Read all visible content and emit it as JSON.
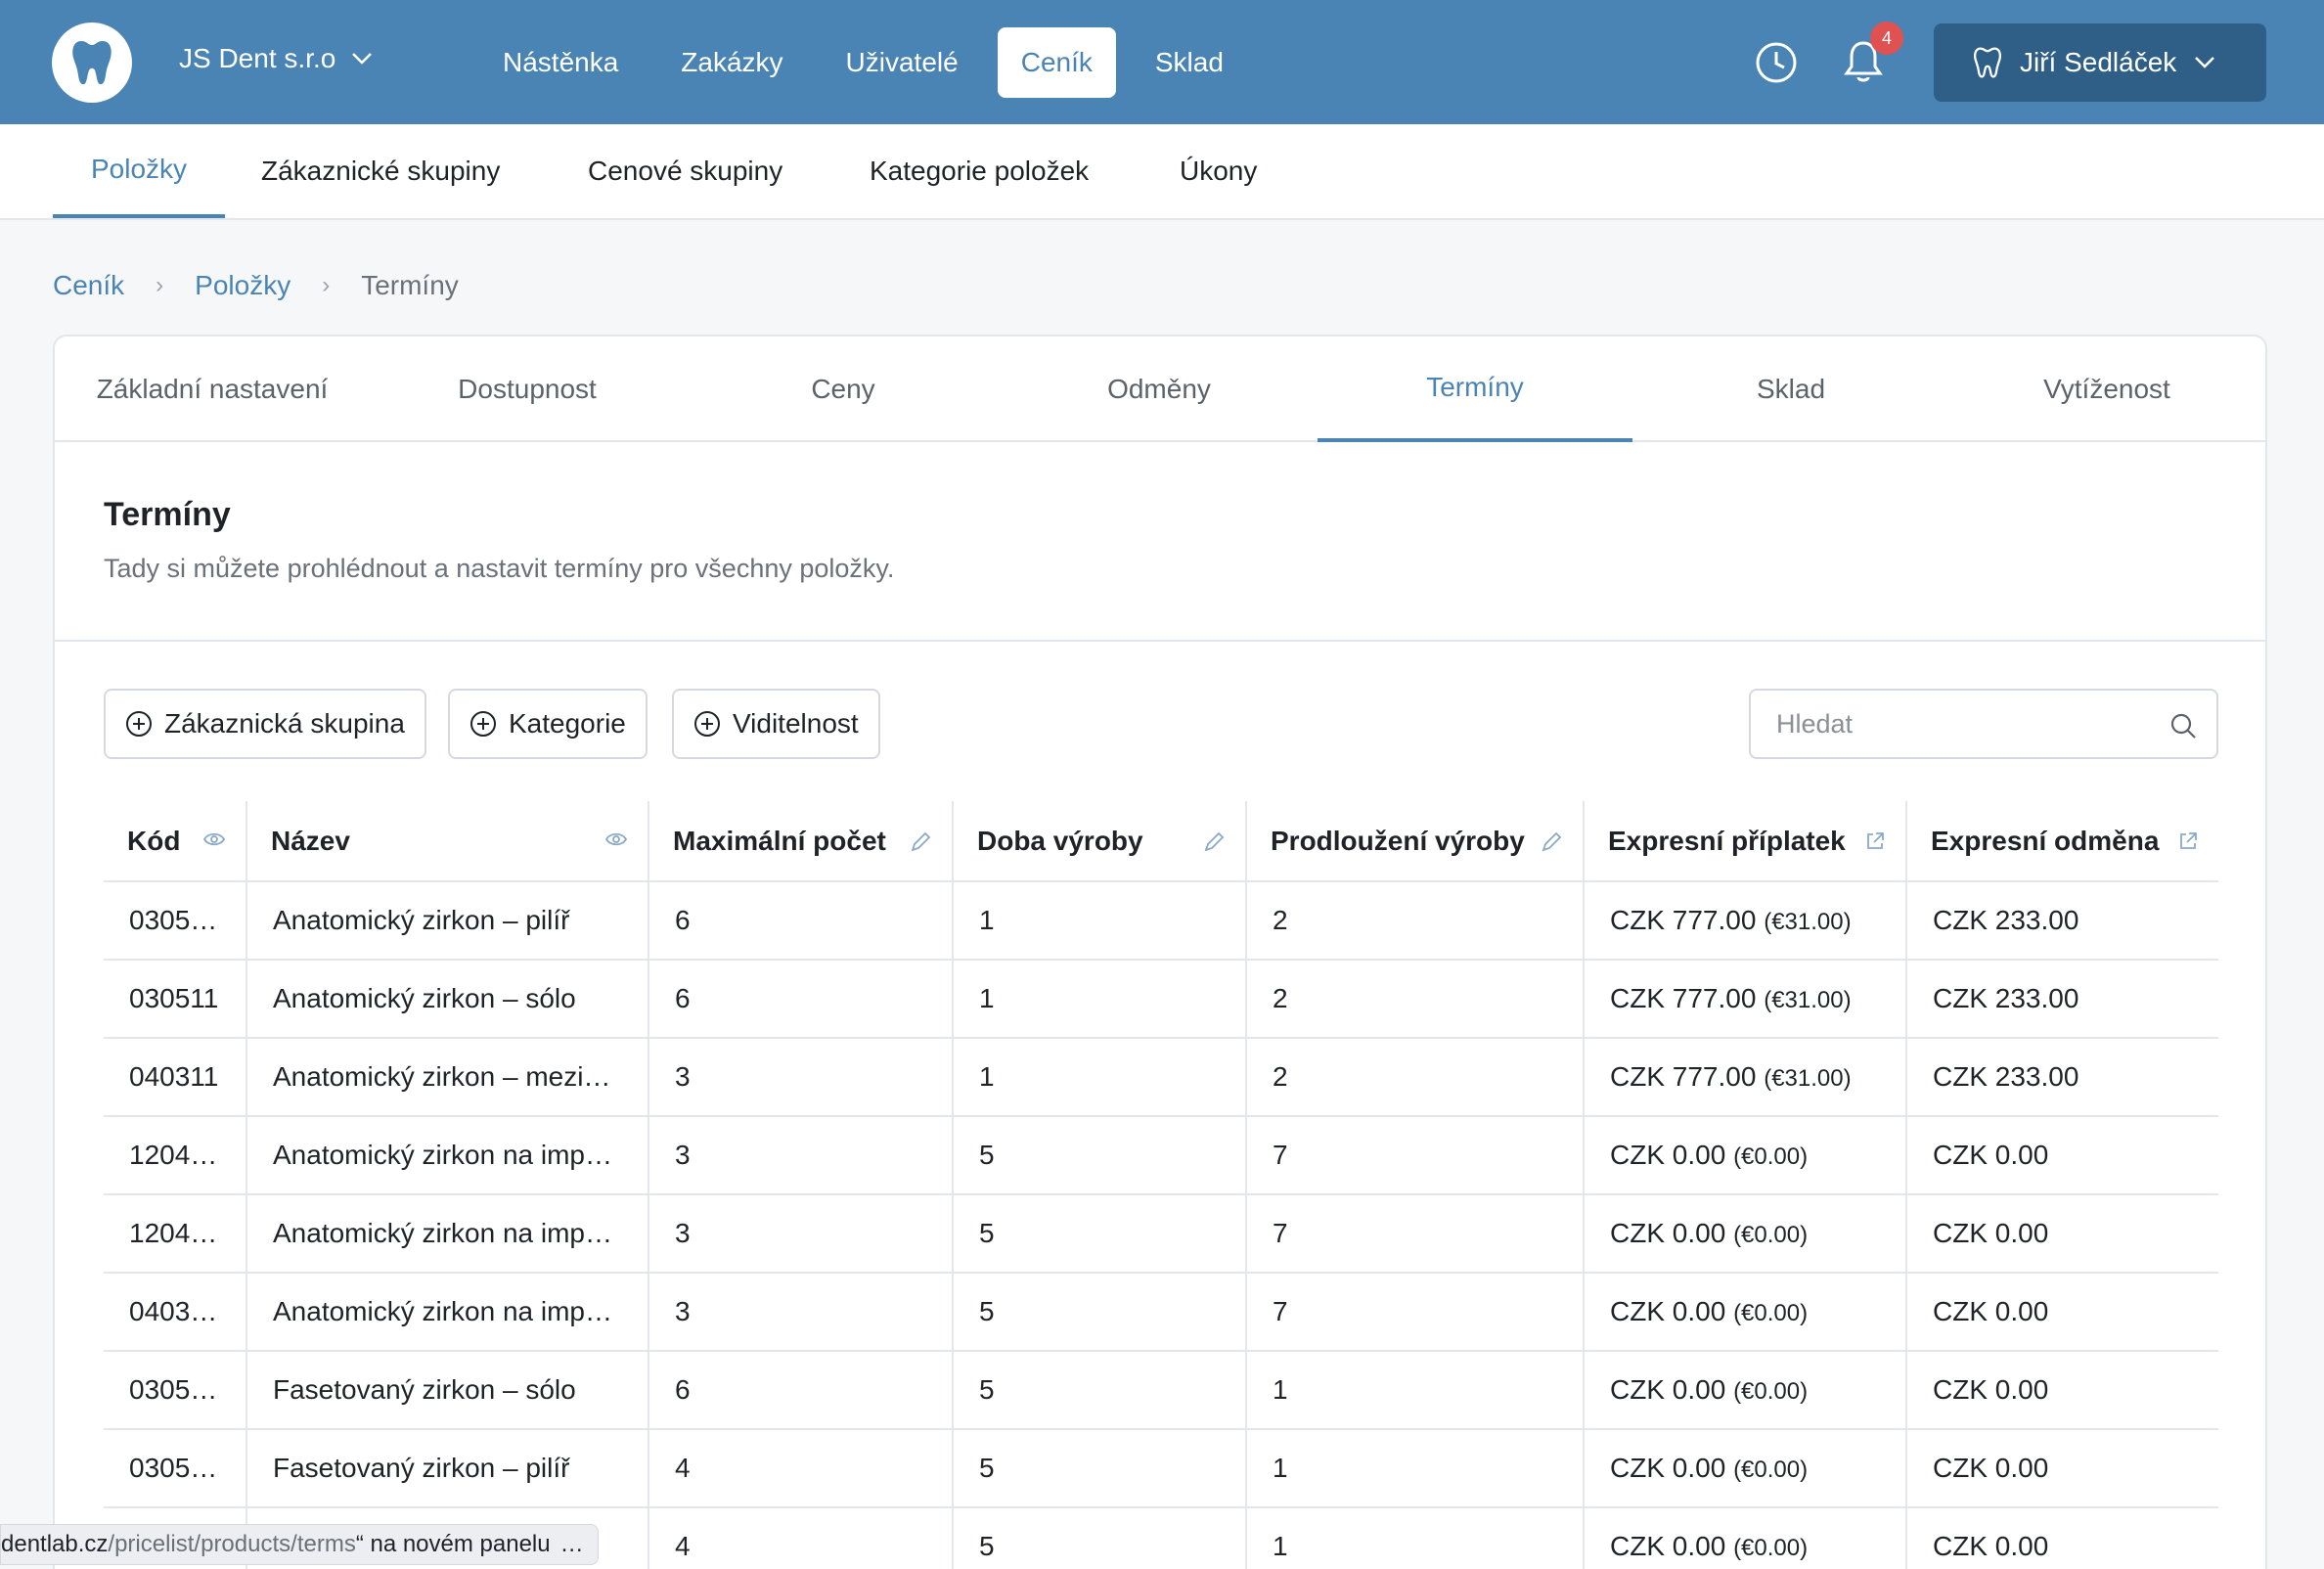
{
  "header": {
    "company": "JS Dent s.r.o",
    "nav": [
      "Nástěnka",
      "Zakázky",
      "Uživatelé",
      "Ceník",
      "Sklad"
    ],
    "active_nav": "Ceník",
    "notifications_count": "4",
    "user_name": "Jiří Sedláček",
    "colors": {
      "primary": "#4a84b4",
      "dark": "#2f5f86",
      "badge": "#e05252"
    }
  },
  "subtabs": [
    "Položky",
    "Zákaznické skupiny",
    "Cenové skupiny",
    "Kategorie položek",
    "Úkony"
  ],
  "breadcrumb": {
    "level1": "Ceník",
    "level2": "Položky",
    "current": "Termíny"
  },
  "panel_tabs": [
    "Základní nastavení",
    "Dostupnost",
    "Ceny",
    "Odměny",
    "Termíny",
    "Sklad",
    "Vytíženost"
  ],
  "section": {
    "title": "Termíny",
    "subtitle": "Tady si můžete prohlédnout a nastavit termíny pro všechny položky."
  },
  "filters": [
    "Zákaznická skupina",
    "Kategorie",
    "Viditelnost"
  ],
  "search": {
    "placeholder": "Hledat"
  },
  "table": {
    "columns": [
      "Kód",
      "Název",
      "Maximální počet",
      "Doba výroby",
      "Prodloužení výroby",
      "Expresní příplatek",
      "Expresní odměna"
    ],
    "rows": [
      [
        "0305…",
        "Anatomický zirkon – pilíř",
        "6",
        "1",
        "2",
        "CZK 777.00",
        "(€31.00)",
        "CZK 233.00"
      ],
      [
        "030511",
        "Anatomický zirkon – sólo",
        "6",
        "1",
        "2",
        "CZK 777.00",
        "(€31.00)",
        "CZK 233.00"
      ],
      [
        "040311",
        "Anatomický zirkon – mezi…",
        "3",
        "1",
        "2",
        "CZK 777.00",
        "(€31.00)",
        "CZK 233.00"
      ],
      [
        "1204…",
        "Anatomický zirkon na imp…",
        "3",
        "5",
        "7",
        "CZK 0.00",
        "(€0.00)",
        "CZK 0.00"
      ],
      [
        "1204…",
        "Anatomický zirkon na imp…",
        "3",
        "5",
        "7",
        "CZK 0.00",
        "(€0.00)",
        "CZK 0.00"
      ],
      [
        "0403…",
        "Anatomický zirkon na imp…",
        "3",
        "5",
        "7",
        "CZK 0.00",
        "(€0.00)",
        "CZK 0.00"
      ],
      [
        "0305…",
        "Fasetovaný zirkon – sólo",
        "6",
        "5",
        "1",
        "CZK 0.00",
        "(€0.00)",
        "CZK 0.00"
      ],
      [
        "0305…",
        "Fasetovaný zirkon – pilíř",
        "4",
        "5",
        "1",
        "CZK 0.00",
        "(€0.00)",
        "CZK 0.00"
      ],
      [
        "",
        "",
        "4",
        "5",
        "1",
        "CZK 0.00",
        "(€0.00)",
        "CZK 0.00"
      ]
    ]
  },
  "statusbar": {
    "host": "dentlab.cz",
    "path": "/pricelist/products/terms",
    "suffix": "“ na novém panelu",
    "tail": "…"
  }
}
